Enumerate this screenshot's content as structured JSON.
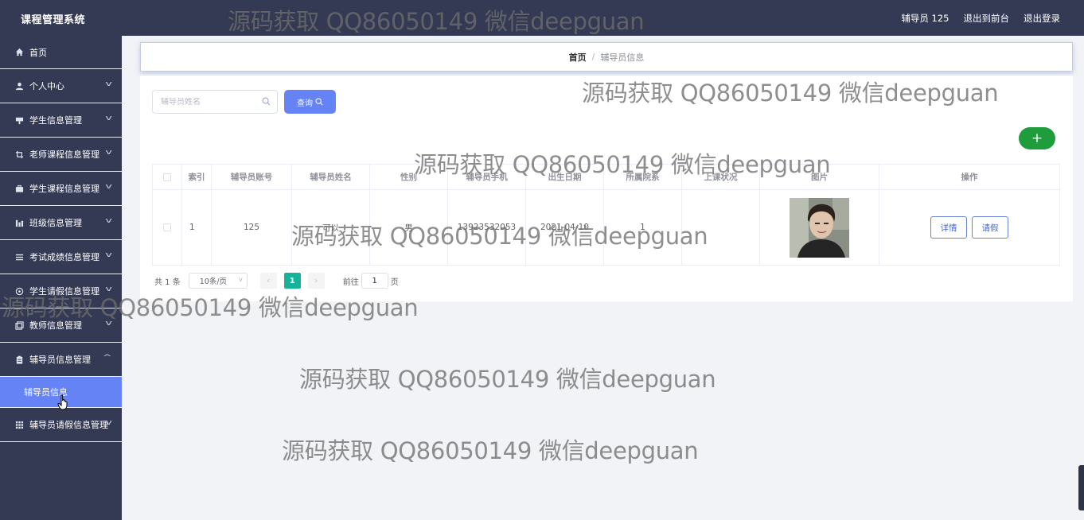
{
  "app": {
    "title": "课程管理系统"
  },
  "header": {
    "user_label": "辅导员 125",
    "front_link": "退出到前台",
    "logout_link": "退出登录"
  },
  "sidebar": {
    "items": [
      {
        "label": "首页",
        "icon": "home-icon",
        "expandable": false
      },
      {
        "label": "个人中心",
        "icon": "user-icon",
        "expandable": true
      },
      {
        "label": "学生信息管理",
        "icon": "tag-icon",
        "expandable": true
      },
      {
        "label": "老师课程信息管理",
        "icon": "crop-icon",
        "expandable": true
      },
      {
        "label": "学生课程信息管理",
        "icon": "briefcase-icon",
        "expandable": true
      },
      {
        "label": "班级信息管理",
        "icon": "bar-chart-icon",
        "expandable": true
      },
      {
        "label": "考试成绩信息管理",
        "icon": "list-icon",
        "expandable": true
      },
      {
        "label": "学生请假信息管理",
        "icon": "circle-icon",
        "expandable": true
      },
      {
        "label": "教师信息管理",
        "icon": "copy-icon",
        "expandable": true
      },
      {
        "label": "辅导员信息管理",
        "icon": "clipboard-icon",
        "expandable": true,
        "expanded": true
      },
      {
        "label": "辅导员请假信息管理",
        "icon": "grid-icon",
        "expandable": true
      }
    ],
    "active_sub": "辅导员信息"
  },
  "breadcrumb": {
    "home": "首页",
    "separator": "/",
    "current": "辅导员信息"
  },
  "search": {
    "placeholder": "辅导员姓名",
    "button_label": "查询"
  },
  "add_button": "+",
  "table": {
    "columns": [
      "索引",
      "辅导员账号",
      "辅导员姓名",
      "性别",
      "辅导员手机",
      "出生日期",
      "所属院系",
      "上课状况",
      "图片",
      "操作"
    ],
    "rows": [
      {
        "index": "1",
        "account": "125",
        "name": "可以",
        "gender": "男",
        "phone": "13923532053",
        "birth": "2021-04-10",
        "department": "1",
        "class_status": "",
        "photo": "portrait",
        "actions": [
          "详情",
          "请假"
        ]
      }
    ]
  },
  "pagination": {
    "total": "共 1 条",
    "page_size": "10条/页",
    "current_page": "1",
    "goto_prefix": "前往",
    "goto_value": "1",
    "goto_suffix": "页"
  },
  "watermark": "源码获取 QQ86050149 微信deepguan",
  "colors": {
    "sidebar_bg": "#343a54",
    "accent": "#6683f5",
    "add_button": "#1f9d3c",
    "page_active": "#16b39a"
  }
}
